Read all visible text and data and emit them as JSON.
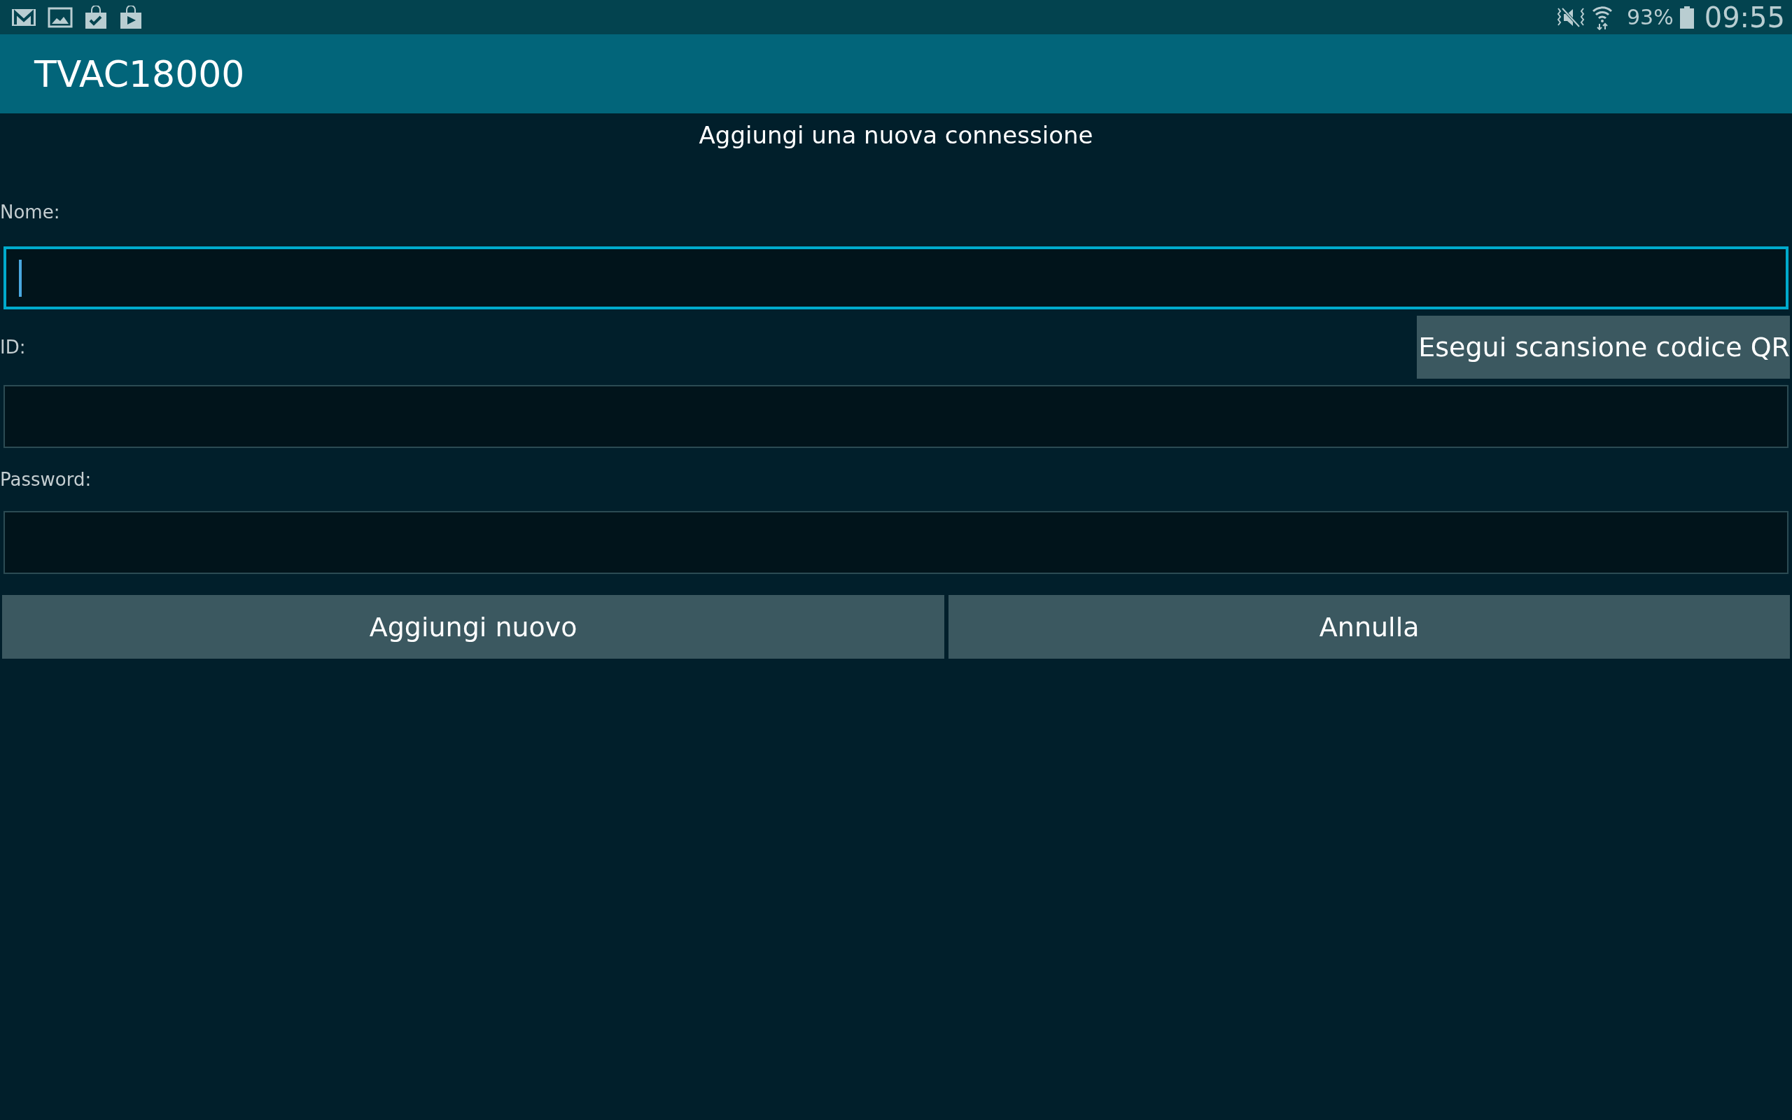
{
  "status_bar": {
    "battery": "93%",
    "time": "09:55"
  },
  "action_bar": {
    "title": "TVAC18000"
  },
  "form": {
    "heading": "Aggiungi una nuova connessione",
    "fields": [
      {
        "label": "Nome:",
        "focused": true
      },
      {
        "label": "ID:",
        "focused": false,
        "action": "Esegui scansione codice QR"
      },
      {
        "label": "Password:",
        "focused": false
      }
    ],
    "buttons": [
      "Aggiungi nuovo",
      "Annulla"
    ]
  }
}
